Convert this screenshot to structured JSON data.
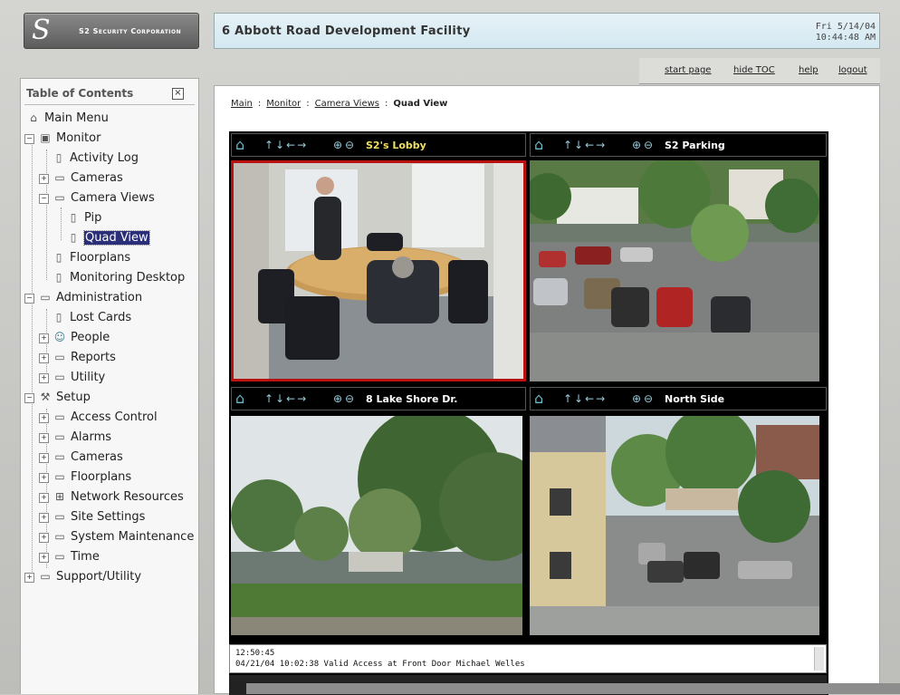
{
  "header": {
    "logo_mark": "S",
    "brand": "S2 Security Corporation",
    "facility": "6 Abbott Road Development Facility",
    "date": "Fri 5/14/04",
    "time": "10:44:48 AM"
  },
  "topnav": {
    "start_page": "start page",
    "hide_toc": "hide TOC",
    "help": "help",
    "logout": "logout"
  },
  "toc": {
    "title": "Table of Contents",
    "close": "×",
    "items": [
      {
        "label": "Main Menu"
      },
      {
        "label": "Monitor"
      },
      {
        "label": "Activity Log"
      },
      {
        "label": "Cameras"
      },
      {
        "label": "Camera Views"
      },
      {
        "label": "Pip"
      },
      {
        "label": "Quad View"
      },
      {
        "label": "Floorplans"
      },
      {
        "label": "Monitoring Desktop"
      },
      {
        "label": "Administration"
      },
      {
        "label": "Lost Cards"
      },
      {
        "label": "People"
      },
      {
        "label": "Reports"
      },
      {
        "label": "Utility"
      },
      {
        "label": "Setup"
      },
      {
        "label": "Access Control"
      },
      {
        "label": "Alarms"
      },
      {
        "label": "Cameras"
      },
      {
        "label": "Floorplans"
      },
      {
        "label": "Network Resources"
      },
      {
        "label": "Site Settings"
      },
      {
        "label": "System Maintenance"
      },
      {
        "label": "Time"
      },
      {
        "label": "Support/Utility"
      }
    ]
  },
  "breadcrumb": {
    "main": "Main",
    "monitor": "Monitor",
    "camera_views": "Camera Views",
    "current": "Quad View",
    "sep": ":"
  },
  "cameras": [
    {
      "name": "S2's Lobby"
    },
    {
      "name": "S2 Parking"
    },
    {
      "name": "8 Lake Shore Dr."
    },
    {
      "name": "North Side"
    }
  ],
  "log": {
    "time": "12:50:45",
    "entry": "04/21/04 10:02:38 Valid Access at Front Door Michael Welles"
  },
  "icons": {
    "home": "home-icon",
    "arrows": "pan-arrows-icon",
    "zoom": "zoom-icon",
    "folder": "folder-icon",
    "page": "page-icon",
    "monitor": "monitor-icon",
    "people": "people-icon",
    "tools": "tools-icon"
  },
  "colors": {
    "active_camera_border": "#b11111",
    "selected_item_bg": "#2b2f7a",
    "title_bar_bg": "#dfeef5"
  }
}
